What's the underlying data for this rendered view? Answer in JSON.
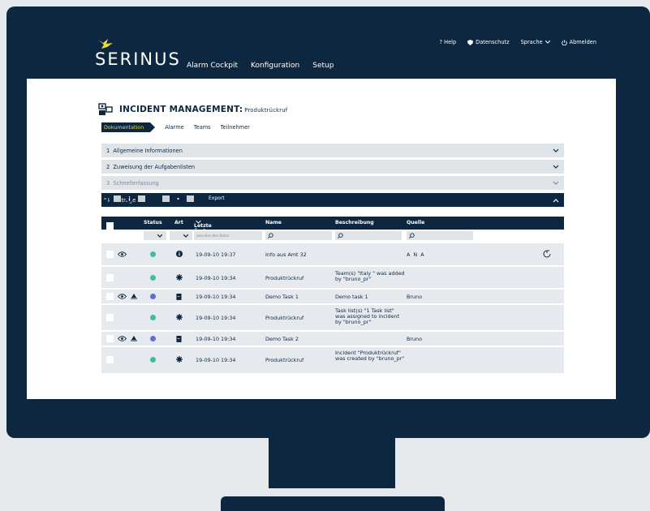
{
  "brand": {
    "name": "SERINUS",
    "bird_color": "#e8d84b"
  },
  "topnav": {
    "help": "? Help",
    "privacy": "Datenschutz",
    "language": "Sprache",
    "logout": "Abmelden"
  },
  "mainnav": [
    "Alarm Cockpit",
    "Konfiguration",
    "Setup"
  ],
  "incident": {
    "title": "INCIDENT MANAGEMENT:",
    "name": "Produktrückruf"
  },
  "subtabs": {
    "active": "Dokumentation",
    "items": [
      "Alarme",
      "Teams",
      "Teilnehmer"
    ]
  },
  "accordion": [
    {
      "num": "1",
      "label": "Allgemeine Informationen"
    },
    {
      "num": "2",
      "label": "Zuweisung der Aufgabenlisten"
    },
    {
      "num": "3",
      "label": "Schnellerfassung"
    },
    {
      "num": "4",
      "label": "Einträge"
    }
  ],
  "toolbar": {
    "export": "Export"
  },
  "table": {
    "headers": {
      "status": "Status",
      "art": "Art",
      "changed": "Letzte Änderung",
      "name": "Name",
      "desc": "Beschreibung",
      "source": "Quelle"
    },
    "date_placeholder": "zwischen den Daten",
    "rows": [
      {
        "date": "19-09-10 19:37",
        "name": "Info aus Amt 32",
        "desc": "",
        "source": "A N A"
      },
      {
        "date": "19-09-10 19:34",
        "name": "Produktrückruf",
        "desc": "Team(s) \"Italy \" was added by \"bruno_pr\"",
        "source": ""
      },
      {
        "date": "19-09-10 19:34",
        "name": "Demo Task 1",
        "desc": "Demo task 1",
        "source": "Bruno"
      },
      {
        "date": "19-09-10 19:34",
        "name": "Produktrückruf",
        "desc": "Task list(s) \"1 Task list\" was assigned to incident by \"bruno_pr\"",
        "source": ""
      },
      {
        "date": "19-09-10 19:34",
        "name": "Demo Task 2",
        "desc": "",
        "source": "Bruno"
      },
      {
        "date": "19-09-10 19:34",
        "name": "Produktrückruf",
        "desc": "Incident \"Produktrückruf\" was created by \"bruno_pr\"",
        "source": ""
      }
    ]
  },
  "colors": {
    "navy": "#0e2740",
    "green": "#3dbf9a",
    "blue": "#5b6fd6",
    "yellow": "#e8d84b"
  }
}
